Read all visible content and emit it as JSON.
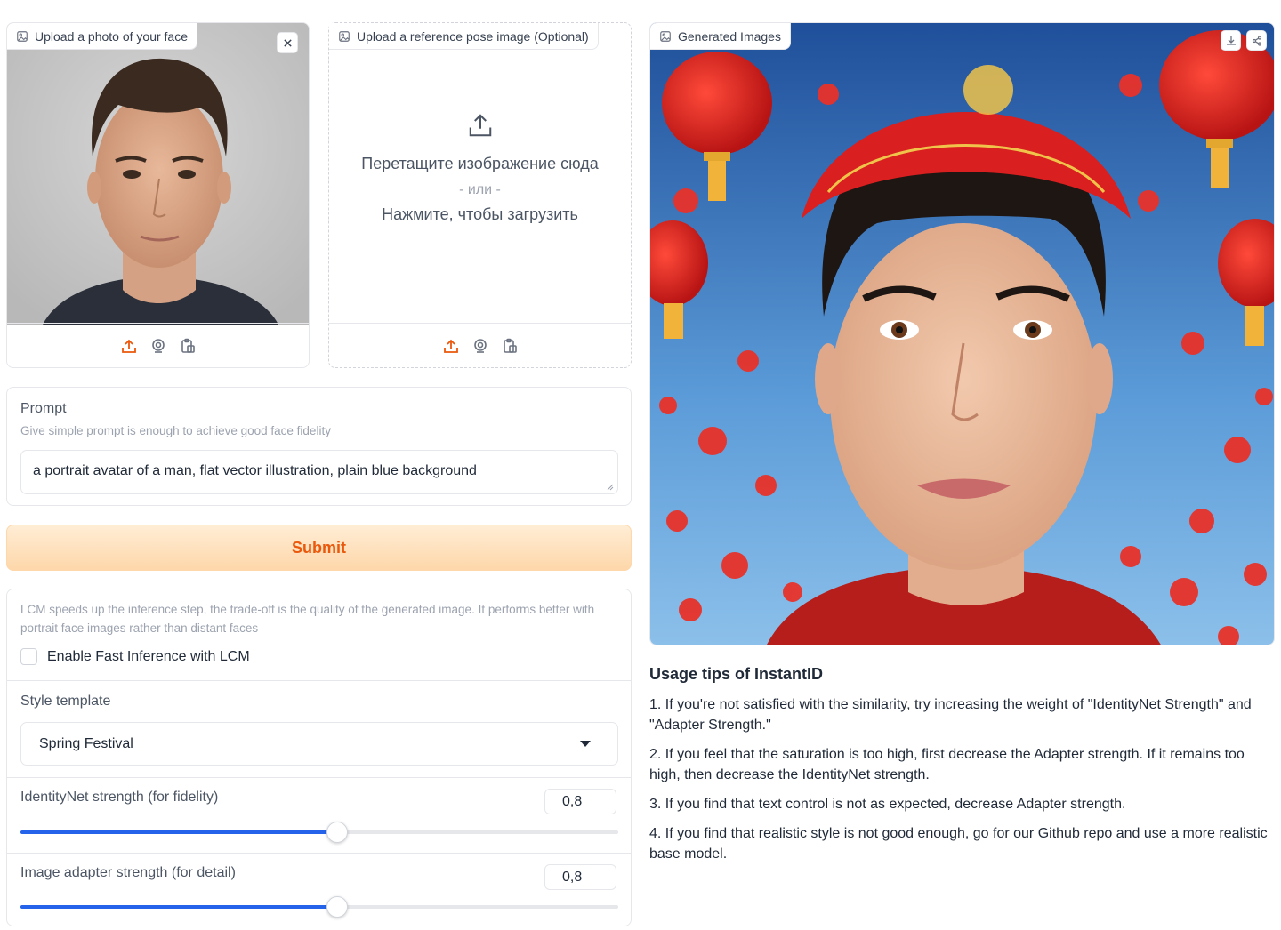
{
  "face_upload": {
    "label": "Upload a photo of your face"
  },
  "pose_upload": {
    "label": "Upload a reference pose image (Optional)",
    "drop_text": "Перетащите изображение сюда",
    "or_text": "- или -",
    "click_text": "Нажмите, чтобы загрузить"
  },
  "prompt": {
    "label": "Prompt",
    "info": "Give simple prompt is enough to achieve good face fidelity",
    "value": "a portrait avatar of a man, flat vector illustration, plain blue background"
  },
  "submit_label": "Submit",
  "lcm": {
    "info": "LCM speeds up the inference step, the trade-off is the quality of the generated image. It performs better with portrait face images rather than distant faces",
    "checkbox_label": "Enable Fast Inference with LCM",
    "checked": false
  },
  "style": {
    "label": "Style template",
    "value": "Spring Festival"
  },
  "identitynet": {
    "label": "IdentityNet strength (for fidelity)",
    "value": "0,8",
    "fraction": 0.53
  },
  "adapter": {
    "label": "Image adapter strength (for detail)",
    "value": "0,8",
    "fraction": 0.53
  },
  "generated": {
    "label": "Generated Images"
  },
  "tips": {
    "title": "Usage tips of InstantID",
    "items": [
      "1. If you're not satisfied with the similarity, try increasing the weight of \"IdentityNet Strength\" and \"Adapter Strength.\"",
      "2. If you feel that the saturation is too high, first decrease the Adapter strength. If it remains too high, then decrease the IdentityNet strength.",
      "3. If you find that text control is not as expected, decrease Adapter strength.",
      "4. If you find that realistic style is not good enough, go for our Github repo and use a more realistic base model."
    ]
  },
  "colors": {
    "accent": "#2563eb",
    "submit_text": "#ea580c",
    "submit_bg": "#fed7aa",
    "icon_orange": "#ea580c"
  }
}
